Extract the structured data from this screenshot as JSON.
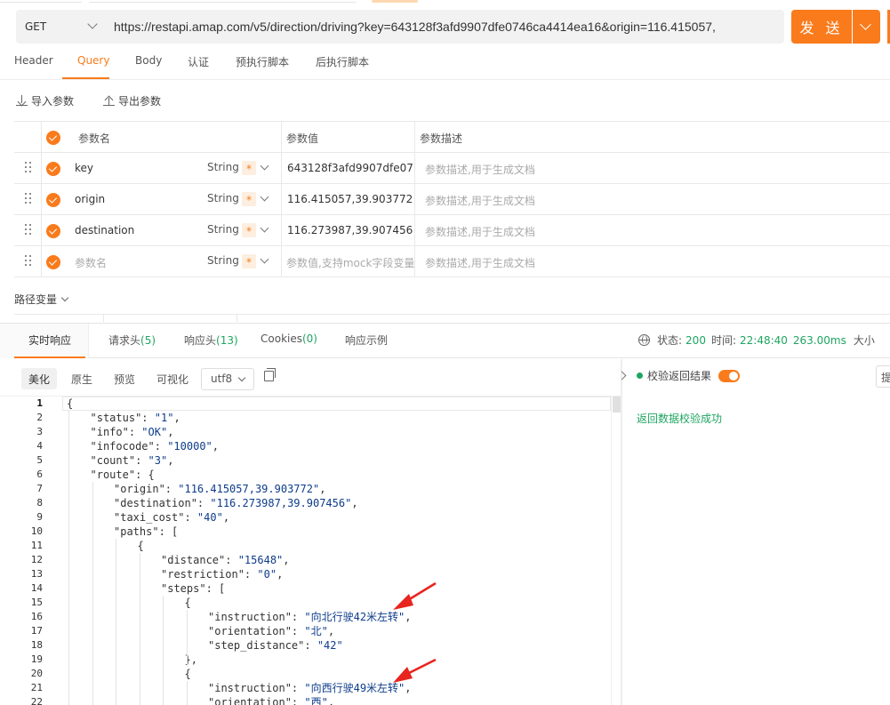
{
  "request": {
    "method": "GET",
    "url": "https://restapi.amap.com/v5/direction/driving?key=643128f3afd9907dfe0746ca4414ea16&origin=116.415057,",
    "send_label": "发 送"
  },
  "tabs": [
    "Header",
    "Query",
    "Body",
    "认证",
    "预执行脚本",
    "后执行脚本"
  ],
  "active_tab": "Query",
  "toolbar": {
    "import_label": "导入参数",
    "export_label": "导出参数"
  },
  "params": {
    "headers": {
      "name": "参数名",
      "value": "参数值",
      "desc": "参数描述"
    },
    "rows": [
      {
        "name": "key",
        "type": "String",
        "required": "*",
        "value": "643128f3afd9907dfe07",
        "desc": "参数描述,用于生成文档"
      },
      {
        "name": "origin",
        "type": "String",
        "required": "*",
        "value": "116.415057,39.903772",
        "desc": "参数描述,用于生成文档"
      },
      {
        "name": "destination",
        "type": "String",
        "required": "*",
        "value": "116.273987,39.907456",
        "desc": "参数描述,用于生成文档"
      },
      {
        "name": "参数名",
        "type": "String",
        "required": "*",
        "value": "参数值,支持mock字段变量",
        "desc": "参数描述,用于生成文档"
      }
    ]
  },
  "path_vars_label": "路径变量",
  "response": {
    "tabs": [
      {
        "label": "实时响应",
        "count": ""
      },
      {
        "label": "请求头",
        "count": "(5)"
      },
      {
        "label": "响应头",
        "count": "(13)"
      },
      {
        "label": "Cookies",
        "count": "(0)"
      },
      {
        "label": "响应示例",
        "count": ""
      }
    ],
    "status_label": "状态:",
    "status_value": "200",
    "time_label": "时间:",
    "time_value": "22:48:40",
    "duration": "263.00ms",
    "size_label": "大小",
    "formats": [
      "美化",
      "原生",
      "预览",
      "可视化"
    ],
    "encoding": "utf8",
    "validate_label": "校验返回结果",
    "validate_result": "返回数据校验成功",
    "right_button": "提"
  },
  "code_lines": [
    {
      "n": "1",
      "indent": 0,
      "t": [
        [
          "p",
          "{"
        ]
      ]
    },
    {
      "n": "2",
      "indent": 1,
      "t": [
        [
          "k",
          "\"status\": "
        ],
        [
          "s",
          "\"1\""
        ],
        [
          "p",
          ","
        ]
      ]
    },
    {
      "n": "3",
      "indent": 1,
      "t": [
        [
          "k",
          "\"info\": "
        ],
        [
          "s",
          "\"OK\""
        ],
        [
          "p",
          ","
        ]
      ]
    },
    {
      "n": "4",
      "indent": 1,
      "t": [
        [
          "k",
          "\"infocode\": "
        ],
        [
          "s",
          "\"10000\""
        ],
        [
          "p",
          ","
        ]
      ]
    },
    {
      "n": "5",
      "indent": 1,
      "t": [
        [
          "k",
          "\"count\": "
        ],
        [
          "s",
          "\"3\""
        ],
        [
          "p",
          ","
        ]
      ]
    },
    {
      "n": "6",
      "indent": 1,
      "t": [
        [
          "k",
          "\"route\": "
        ],
        [
          "p",
          "{"
        ]
      ]
    },
    {
      "n": "7",
      "indent": 2,
      "t": [
        [
          "k",
          "\"origin\": "
        ],
        [
          "s",
          "\"116.415057,39.903772\""
        ],
        [
          "p",
          ","
        ]
      ]
    },
    {
      "n": "8",
      "indent": 2,
      "t": [
        [
          "k",
          "\"destination\": "
        ],
        [
          "s",
          "\"116.273987,39.907456\""
        ],
        [
          "p",
          ","
        ]
      ]
    },
    {
      "n": "9",
      "indent": 2,
      "t": [
        [
          "k",
          "\"taxi_cost\": "
        ],
        [
          "s",
          "\"40\""
        ],
        [
          "p",
          ","
        ]
      ]
    },
    {
      "n": "10",
      "indent": 2,
      "t": [
        [
          "k",
          "\"paths\": "
        ],
        [
          "p",
          "["
        ]
      ]
    },
    {
      "n": "11",
      "indent": 3,
      "t": [
        [
          "p",
          "{"
        ]
      ]
    },
    {
      "n": "12",
      "indent": 4,
      "t": [
        [
          "k",
          "\"distance\": "
        ],
        [
          "s",
          "\"15648\""
        ],
        [
          "p",
          ","
        ]
      ]
    },
    {
      "n": "13",
      "indent": 4,
      "t": [
        [
          "k",
          "\"restriction\": "
        ],
        [
          "s",
          "\"0\""
        ],
        [
          "p",
          ","
        ]
      ]
    },
    {
      "n": "14",
      "indent": 4,
      "t": [
        [
          "k",
          "\"steps\": "
        ],
        [
          "p",
          "["
        ]
      ]
    },
    {
      "n": "15",
      "indent": 5,
      "t": [
        [
          "p",
          "{"
        ]
      ]
    },
    {
      "n": "16",
      "indent": 6,
      "t": [
        [
          "k",
          "\"instruction\": "
        ],
        [
          "s",
          "\"向北行驶42米左转\""
        ],
        [
          "p",
          ","
        ]
      ]
    },
    {
      "n": "17",
      "indent": 6,
      "t": [
        [
          "k",
          "\"orientation\": "
        ],
        [
          "s",
          "\"北\""
        ],
        [
          "p",
          ","
        ]
      ]
    },
    {
      "n": "18",
      "indent": 6,
      "t": [
        [
          "k",
          "\"step_distance\": "
        ],
        [
          "s",
          "\"42\""
        ]
      ]
    },
    {
      "n": "19",
      "indent": 5,
      "t": [
        [
          "p",
          "},"
        ]
      ]
    },
    {
      "n": "20",
      "indent": 5,
      "t": [
        [
          "p",
          "{"
        ]
      ]
    },
    {
      "n": "21",
      "indent": 6,
      "t": [
        [
          "k",
          "\"instruction\": "
        ],
        [
          "s",
          "\"向西行驶49米左转\""
        ],
        [
          "p",
          ","
        ]
      ]
    },
    {
      "n": "22",
      "indent": 6,
      "t": [
        [
          "k",
          "\"orientation\": "
        ],
        [
          "s",
          "\"西\""
        ],
        [
          "p",
          ","
        ]
      ]
    }
  ],
  "colors": {
    "accent": "#f97b1c",
    "success": "#1fa561",
    "string": "#0d3c8a",
    "annotation_arrow": "#e8251f"
  }
}
